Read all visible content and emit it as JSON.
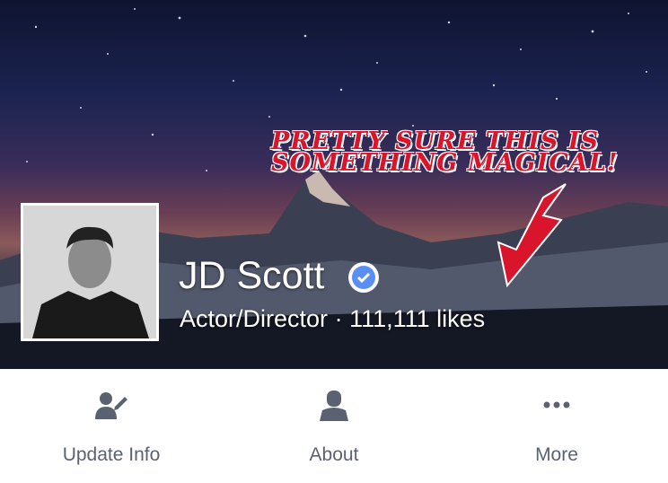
{
  "page": {
    "name": "JD Scott",
    "category": "Actor/Director",
    "separator": "·",
    "likes": "111,111 likes",
    "verified": true
  },
  "cover": {
    "annotation_line1": "Pretty sure this is",
    "annotation_line2": "Something magical!",
    "annotation_color": "#d9152b"
  },
  "actions": [
    {
      "label": "Update Info",
      "icon": "edit-person-icon"
    },
    {
      "label": "About",
      "icon": "person-icon"
    },
    {
      "label": "More",
      "icon": "more-dots-icon"
    }
  ],
  "colors": {
    "verified_badge": "#5b8ef3",
    "action_icon": "#5a6170"
  }
}
